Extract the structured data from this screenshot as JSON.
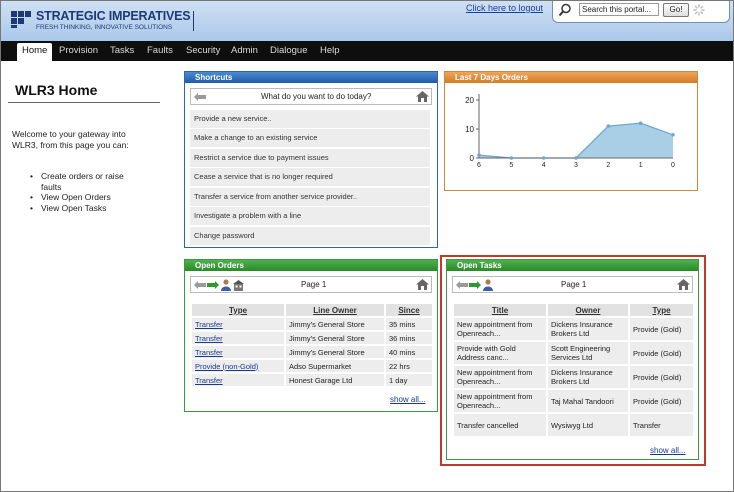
{
  "brand": {
    "name": "STRATEGIC IMPERATIVES",
    "tagline": "FRESH THINKING, INNOVATIVE SOLUTIONS"
  },
  "header": {
    "logout_link": "Click here to logout",
    "search_placeholder": "Search this portal...",
    "search_value": "Search this portal...",
    "go_label": "Go!"
  },
  "nav": {
    "items": [
      "Home",
      "Provision",
      "Tasks",
      "Faults",
      "Security",
      "Admin",
      "Dialogue",
      "Help"
    ],
    "active": "Home"
  },
  "page": {
    "title": "WLR3 Home",
    "welcome": "Welcome to your gateway into WLR3, from this page you can:",
    "bullets": [
      "Create orders or raise faults",
      "View Open Orders",
      "View Open Tasks"
    ]
  },
  "shortcuts": {
    "header": "Shortcuts",
    "prompt": "What do you want to do today?",
    "items": [
      "Provide a new service..",
      "Make a change to an existing service",
      "Restrict a service due to payment issues",
      "Cease a service that is no longer required",
      "Transfer a service from another service provider..",
      "Investigate a problem with a line",
      "Change password"
    ]
  },
  "orders_chart": {
    "header": "Last 7 Days Orders"
  },
  "chart_data": {
    "type": "area",
    "title": "Last 7 Days Orders",
    "x": [
      6,
      5,
      4,
      3,
      2,
      1,
      0
    ],
    "values": [
      1,
      0,
      0,
      0,
      11,
      12,
      8
    ],
    "xlim": [
      6,
      0
    ],
    "ylim": [
      0,
      20
    ],
    "yticks": [
      0,
      10,
      20
    ],
    "xticks": [
      6,
      5,
      4,
      3,
      2,
      1,
      0
    ],
    "xlabel": "",
    "ylabel": "",
    "fill_color": "#a9cfe6",
    "line_color": "#6fa8cf"
  },
  "open_orders": {
    "header": "Open Orders",
    "page_label": "Page 1",
    "columns": [
      "Type",
      "Line Owner",
      "Since"
    ],
    "rows": [
      [
        "Transfer",
        "Jimmy's General Store",
        "35 mins"
      ],
      [
        "Transfer",
        "Jimmy's General Store",
        "36 mins"
      ],
      [
        "Transfer",
        "Jimmy's General Store",
        "40 mins"
      ],
      [
        "Provide (non-Gold)",
        "Adso Supermarket",
        "22 hrs"
      ],
      [
        "Transfer",
        "Honest Garage Ltd",
        "1 day"
      ]
    ],
    "show_all": "show all..."
  },
  "open_tasks": {
    "header": "Open Tasks",
    "page_label": "Page 1",
    "columns": [
      "Title",
      "Owner",
      "Type"
    ],
    "rows": [
      [
        "New appointment from Openreach...",
        "Dickens Insurance Brokers Ltd",
        "Provide (Gold)"
      ],
      [
        "Provide with Gold Address canc...",
        "Scott Engineering Services Ltd",
        "Provide (Gold)"
      ],
      [
        "New appointment from Openreach...",
        "Dickens Insurance Brokers Ltd",
        "Provide (Gold)"
      ],
      [
        "New appointment from Openreach...",
        "Taj Mahal Tandoori",
        "Provide (Gold)"
      ],
      [
        "Transfer cancelled",
        "Wysiwyg Ltd",
        "Transfer"
      ]
    ],
    "show_all": "show all..."
  },
  "colors": {
    "nav_bg": "#0e0e0e",
    "shortcuts_header": "#2f6db5",
    "chart_header": "#e08a33",
    "orders_header": "#34a034",
    "highlight": "#c0392b"
  }
}
